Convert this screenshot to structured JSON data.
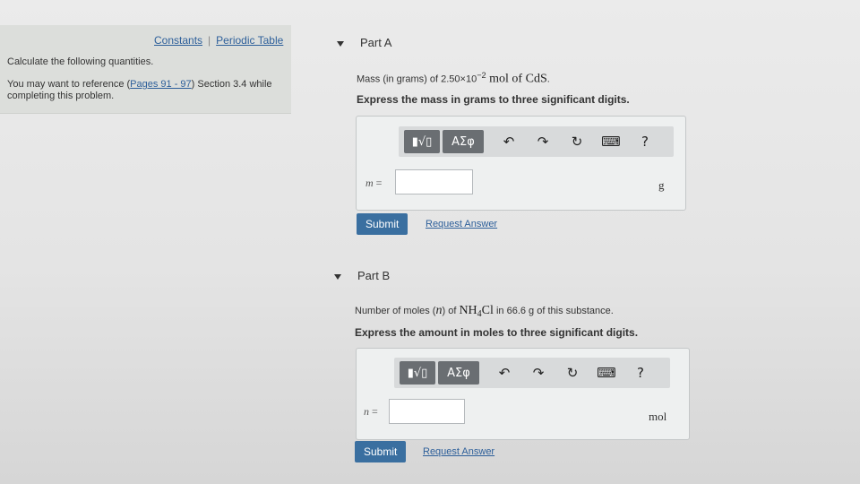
{
  "sidebar": {
    "links": {
      "constants": "Constants",
      "separator": "|",
      "periodic_table": "Periodic Table"
    },
    "instructions": "Calculate the following quantities.",
    "reference_prefix": "You may want to reference (",
    "reference_link": "Pages 91 - 97",
    "reference_suffix": ") Section 3.4 while completing this problem."
  },
  "part_a": {
    "title": "Part A",
    "question_prefix": "Mass (in grams) of 2.50×10",
    "question_exp": "−2",
    "question_mid": " mol of ",
    "question_formula": "CdS",
    "question_suffix": ".",
    "instruction": "Express the mass in grams to three significant digits.",
    "var": "m",
    "eq": "=",
    "value": "",
    "unit": "g",
    "submit": "Submit",
    "request": "Request Answer"
  },
  "part_b": {
    "title": "Part B",
    "question_prefix": "Number of moles (",
    "question_var": "n",
    "question_mid": ") of ",
    "question_formula_a": "NH",
    "question_formula_sub": "4",
    "question_formula_b": "Cl",
    "question_suffix": " in 66.6  g of this substance.",
    "instruction": "Express the amount in moles to three significant digits.",
    "var": "n",
    "eq": "=",
    "value": "",
    "unit": "mol",
    "submit": "Submit",
    "request": "Request Answer"
  },
  "toolbar": {
    "templates_label": "▮√▯",
    "symbols_label": "ΑΣφ",
    "undo_icon": "↶",
    "redo_icon": "↷",
    "reset_icon": "↻",
    "keyboard_icon": "⌨",
    "help_label": "?"
  }
}
